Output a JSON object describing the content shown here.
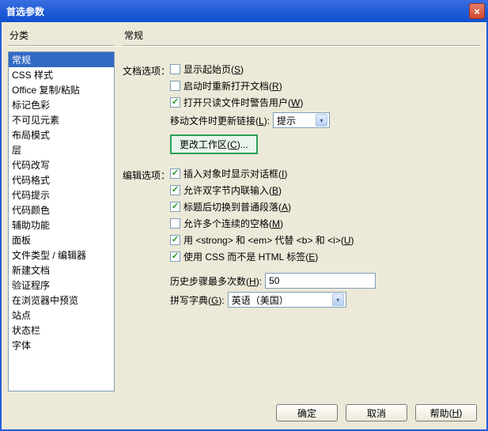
{
  "window": {
    "title": "首选参数",
    "close": "×"
  },
  "left": {
    "header": "分类",
    "items": [
      "常规",
      "CSS 样式",
      "Office 复制/粘贴",
      "标记色彩",
      "不可见元素",
      "布局模式",
      "层",
      "代码改写",
      "代码格式",
      "代码提示",
      "代码颜色",
      "辅助功能",
      "面板",
      "文件类型 / 编辑器",
      "新建文档",
      "验证程序",
      "在浏览器中预览",
      "站点",
      "状态栏",
      "字体"
    ]
  },
  "right": {
    "header": "常规",
    "docopts": {
      "label": "文档选项：",
      "startpage": "显示起始页",
      "startpage_key": "S",
      "reopen": "启动时重新打开文档",
      "reopen_key": "R",
      "warn_readonly": "打开只读文件时警告用户",
      "warn_readonly_key": "W",
      "movefiles": "移动文件时更新链接",
      "movefiles_key": "L",
      "movefiles_select": "提示",
      "change_workspace": "更改工作区",
      "change_workspace_key": "C",
      "change_workspace_tail": "..."
    },
    "editopts": {
      "label": "编辑选项：",
      "insert_dialog": "插入对象时显示对话框",
      "insert_dialog_key": "I",
      "dbcs": "允许双字节内联输入",
      "dbcs_key": "B",
      "heading_para": "标题后切换到普通段落",
      "heading_para_key": "A",
      "multi_space": "允许多个连续的空格",
      "multi_space_key": "M",
      "strongem_pre": "用 ",
      "strongem_mid1": " 和 ",
      "strongem_mid2": " 代替 ",
      "strongem_mid3": " 和 ",
      "strongem_key": "U",
      "tag1": "<strong>",
      "tag2": "<em>",
      "tag3": "<b>",
      "tag4": "<i>",
      "css_html": "使用 CSS 而不是 HTML 标签",
      "css_html_key": "E",
      "history_label": "历史步骤最多次数",
      "history_key": "H",
      "history_value": "50",
      "dict_label": "拼写字典",
      "dict_key": "G",
      "dict_value": "英语（美国）"
    }
  },
  "buttons": {
    "ok": "确定",
    "cancel": "取消",
    "help": "帮助",
    "help_key": "H"
  }
}
